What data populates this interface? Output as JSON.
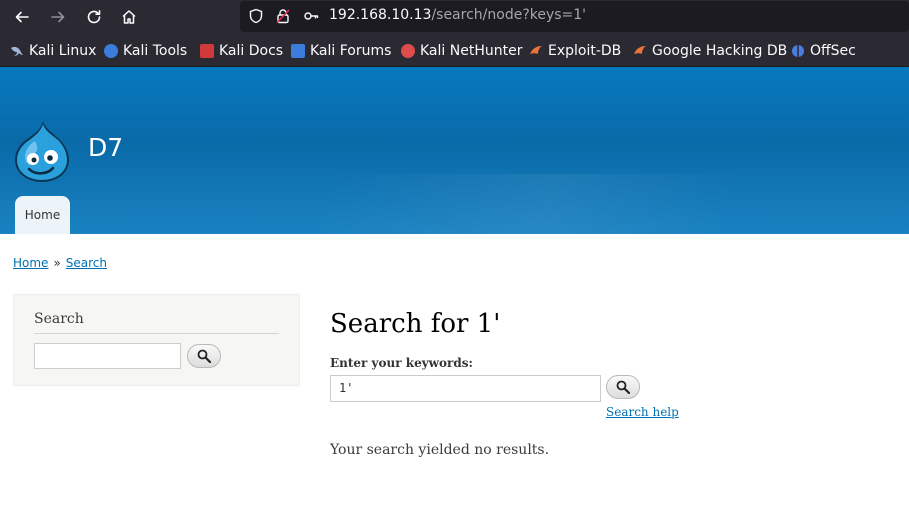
{
  "browser": {
    "url_host": "192.168.10.13",
    "url_path": "/search/node?keys=1'",
    "bookmarks": [
      {
        "label": "Kali Linux",
        "icon": "kali-dragon-icon",
        "color": "#9fb8d8"
      },
      {
        "label": "Kali Tools",
        "icon": "kali-tools-icon",
        "color": "#3b7ddd"
      },
      {
        "label": "Kali Docs",
        "icon": "kali-docs-icon",
        "color": "#d23a3a"
      },
      {
        "label": "Kali Forums",
        "icon": "kali-forums-icon",
        "color": "#3b7ddd"
      },
      {
        "label": "Kali NetHunter",
        "icon": "kali-nethunter-icon",
        "color": "#e04b4b"
      },
      {
        "label": "Exploit-DB",
        "icon": "exploit-db-icon",
        "color": "#e8743a"
      },
      {
        "label": "Google Hacking DB",
        "icon": "ghdb-icon",
        "color": "#e8743a"
      },
      {
        "label": "OffSec",
        "icon": "offsec-icon",
        "color": "#4a7de0"
      }
    ]
  },
  "site": {
    "name": "D7",
    "nav_home": "Home",
    "header_color": "#0779bf"
  },
  "breadcrumb": {
    "home": "Home",
    "separator": "»",
    "current": "Search"
  },
  "sidebar": {
    "title": "Search",
    "input_value": ""
  },
  "main": {
    "title": "Search for 1'",
    "keywords_label": "Enter your keywords:",
    "keywords_value": "1'",
    "search_help": "Search help",
    "result_text": "Your search yielded no results."
  }
}
